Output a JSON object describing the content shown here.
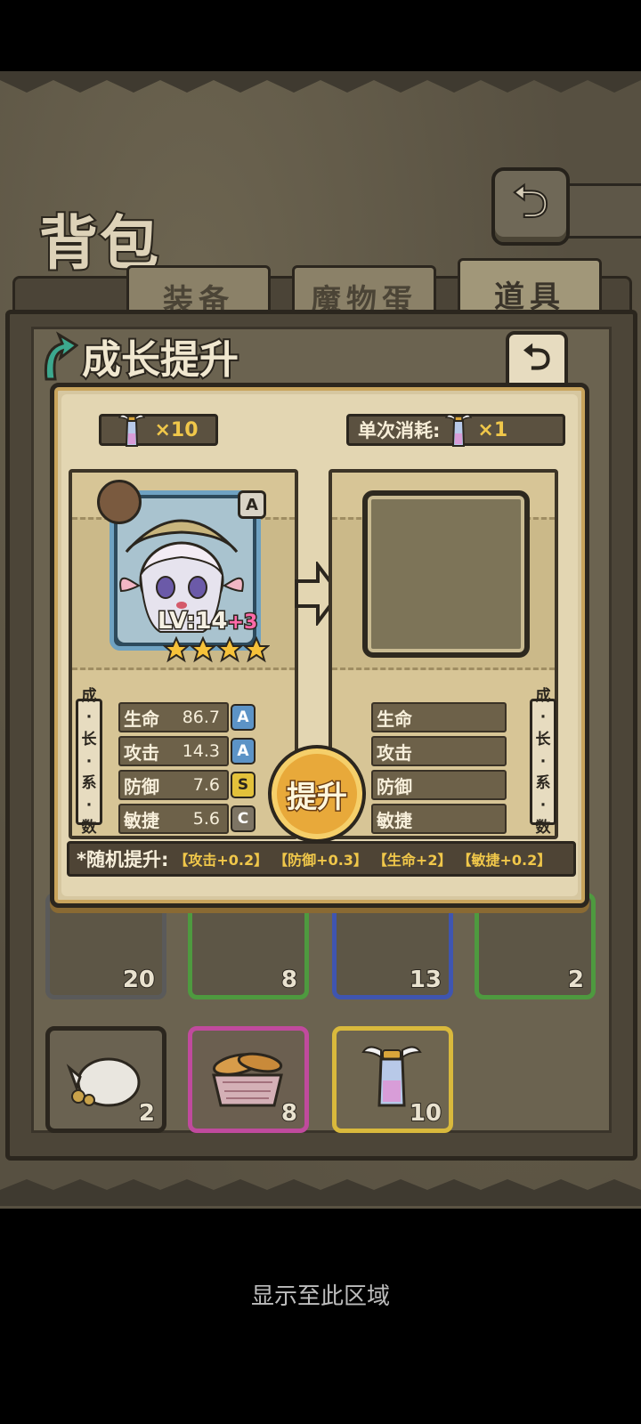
{
  "header": {
    "title": "背包",
    "back_icon": "return-arrow-icon"
  },
  "tabs": [
    {
      "label": "装备",
      "active": false
    },
    {
      "label": "魔物蛋",
      "active": false
    },
    {
      "label": "道具",
      "active": true
    }
  ],
  "inventory": {
    "slots": [
      {
        "item": "coin-bag-icon",
        "count": "2",
        "rarity_color": "#5a5a5a"
      },
      {
        "item": "bread-basket-icon",
        "count": "8",
        "rarity_color": "#c04a9d"
      },
      {
        "item": "winged-potion-icon",
        "count": "10",
        "rarity_color": "#d9b93c"
      }
    ],
    "partial_counts": [
      "20",
      "8",
      "13",
      "2"
    ]
  },
  "modal": {
    "title": "成长提升",
    "owned_potions": "×10",
    "cost_label": "单次消耗:",
    "cost_amount": "×1",
    "character": {
      "grade": "A",
      "level_label": "LV:",
      "level": "14",
      "level_bonus": "+3",
      "stars": 4
    },
    "side_label_left": [
      "成",
      "长",
      "系",
      "数"
    ],
    "side_label_right": [
      "成",
      "长",
      "系",
      "数"
    ],
    "stats_current": [
      {
        "name": "生命",
        "value": "86.7",
        "grade": "A",
        "grade_color": "#5c93c6"
      },
      {
        "name": "攻击",
        "value": "14.3",
        "grade": "A",
        "grade_color": "#5c93c6"
      },
      {
        "name": "防御",
        "value": "7.6",
        "grade": "S",
        "grade_color": "#e3c13a"
      },
      {
        "name": "敏捷",
        "value": "5.6",
        "grade": "C",
        "grade_color": "#7d7464"
      }
    ],
    "stats_next": [
      {
        "name": "生命"
      },
      {
        "name": "攻击"
      },
      {
        "name": "防御"
      },
      {
        "name": "敏捷"
      }
    ],
    "upgrade_button": "提升",
    "random_label": "*随机提升:",
    "random_bonuses": [
      "【攻击+0.2】",
      "【防御+0.3】",
      "【生命+2】",
      "【敏捷+0.2】"
    ]
  },
  "footer": {
    "text": "显示至此区域"
  },
  "colors": {
    "accent_gold": "#f0c74a",
    "parchment": "#e3d6b2",
    "frame_dark": "#2b261e"
  }
}
